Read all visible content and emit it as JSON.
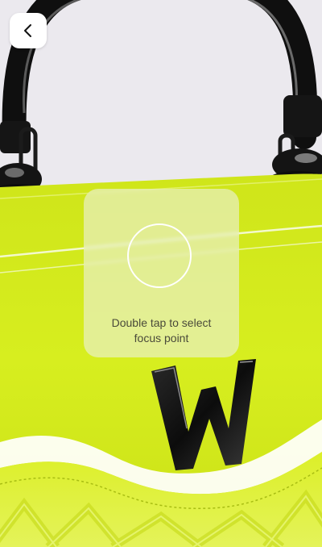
{
  "back_button": {
    "icon": "chevron-left-icon"
  },
  "focus": {
    "hint": "Double tap to select focus point"
  },
  "product": {
    "letter": "W"
  },
  "colors": {
    "bag": "#d6ec1c",
    "background": "#ebe9ee",
    "handle": "#111111"
  }
}
